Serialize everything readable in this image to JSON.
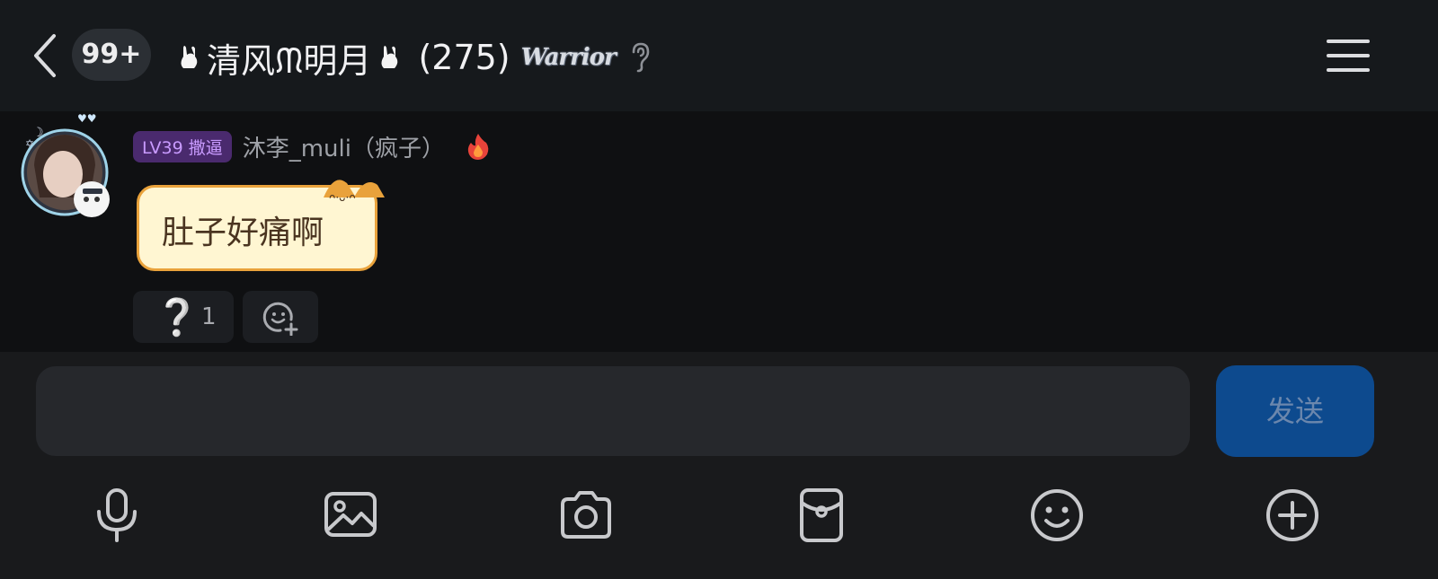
{
  "header": {
    "unread_count": "99+",
    "group_name": "清风ᙏ明月",
    "member_count": "(275)",
    "badge_text": "Warrior",
    "icons": [
      "back-icon",
      "bunny-icon",
      "ear-icon",
      "menu-icon"
    ]
  },
  "message": {
    "level_badge": "LV39 撒逼",
    "sender_name": "沐李_muli（疯子）",
    "text": "肚子好痛啊",
    "reactions": {
      "question_emoji": "❔",
      "question_count": "1"
    },
    "icons": [
      "avatar",
      "fire-icon",
      "add-reaction-icon"
    ]
  },
  "composer": {
    "input_value": "",
    "send_label": "发送",
    "tools": [
      "microphone-icon",
      "image-icon",
      "camera-icon",
      "red-packet-icon",
      "emoji-icon",
      "plus-icon"
    ]
  },
  "colors": {
    "header_bg": "#16191c",
    "chat_bg": "#0f1012",
    "composer_bg": "#191a1c",
    "send_button": "#0d4a8e",
    "level_badge": "#c99bff",
    "bubble_fill": "#fff6d2",
    "bubble_border": "#e9a23b"
  }
}
